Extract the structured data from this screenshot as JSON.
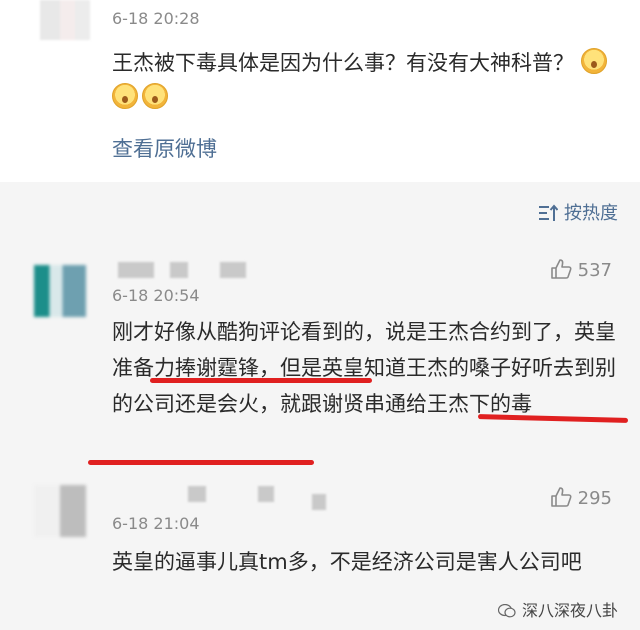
{
  "post": {
    "time": "6-18 20:28",
    "text": "王杰被下毒具体是因为什么事？有没有大神科普？",
    "view_original": "查看原微博"
  },
  "sort": {
    "label": "按热度",
    "icon": "sort-icon"
  },
  "comments": [
    {
      "time": "6-18 20:54",
      "likes": "537",
      "text": "刚才好像从酷狗评论看到的，说是王杰合约到了，英皇准备力捧谢霆锋，但是英皇知道王杰的嗓子好听去到别的公司还是会火，就跟谢贤串通给王杰下的毒"
    },
    {
      "time": "6-18 21:04",
      "likes": "295",
      "text": "英皇的逼事儿真tm多，不是经济公司是害人公司吧"
    }
  ],
  "watermark": "深八深夜八卦",
  "colors": {
    "link": "#4f6f94",
    "highlight": "#e02020",
    "background": "#f5f5f5"
  }
}
